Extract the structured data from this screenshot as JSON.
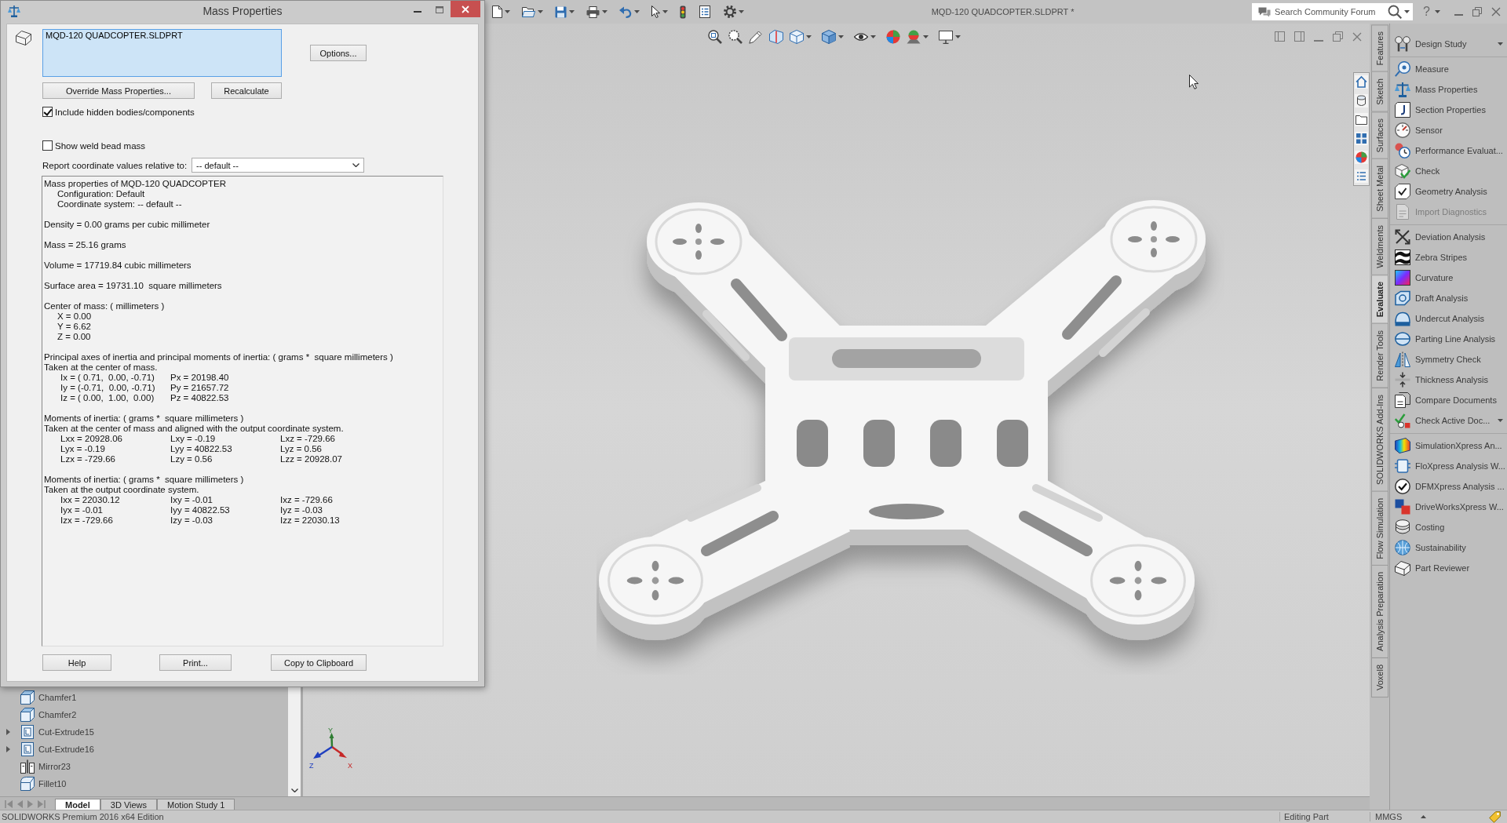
{
  "app": {
    "title": "MQD-120 QUADCOPTER.SLDPRT *",
    "search": {
      "placeholder": "Search Community Forum"
    },
    "help": "?"
  },
  "dialog": {
    "title": "Mass Properties",
    "selection": "MQD-120 QUADCOPTER.SLDPRT",
    "options_button": "Options...",
    "override_button": "Override Mass Properties...",
    "recalculate_button": "Recalculate",
    "checkboxes": [
      {
        "label": "Include hidden bodies/components",
        "checked": true
      },
      {
        "label": "Show weld bead mass",
        "checked": false
      }
    ],
    "coordinate_label": "Report coordinate values relative to:",
    "coordinate_select": "-- default --",
    "results": [
      {
        "lines": [
          "Mass properties of MQD-120 QUADCOPTER"
        ],
        "children": [
          "Configuration: Default",
          "Coordinate system: -- default --"
        ]
      },
      {
        "lines": [
          "Density = 0.00 grams per cubic millimeter"
        ]
      },
      {
        "lines": [
          "Mass = 25.16 grams"
        ]
      },
      {
        "lines": [
          "Volume = 17719.84 cubic millimeters"
        ]
      },
      {
        "lines": [
          "Surface area = 19731.10  square millimeters"
        ]
      },
      {
        "lines": [
          "Center of mass: ( millimeters )"
        ],
        "children": [
          "X = 0.00",
          "Y = 6.62",
          "Z = 0.00"
        ]
      },
      {
        "lines": [
          "Principal axes of inertia and principal moments of inertia: ( grams *  square millimeters )",
          "Taken at the center of mass."
        ],
        "rows": [
          [
            "Ix = ( 0.71,  0.00, -0.71)",
            "Px = 20198.40"
          ],
          [
            "Iy = (-0.71,  0.00, -0.71)",
            "Py = 21657.72"
          ],
          [
            "Iz = ( 0.00,  1.00,  0.00)",
            "Pz = 40822.53"
          ]
        ]
      },
      {
        "lines": [
          "Moments of inertia: ( grams *  square millimeters )",
          "Taken at the center of mass and aligned with the output coordinate system."
        ],
        "rows": [
          [
            "Lxx = 20928.06",
            "Lxy = -0.19",
            "Lxz = -729.66"
          ],
          [
            "Lyx = -0.19",
            "Lyy = 40822.53",
            "Lyz = 0.56"
          ],
          [
            "Lzx = -729.66",
            "Lzy = 0.56",
            "Lzz = 20928.07"
          ]
        ]
      },
      {
        "lines": [
          "Moments of inertia: ( grams *  square millimeters )",
          "Taken at the output coordinate system."
        ],
        "rows": [
          [
            "Ixx = 22030.12",
            "Ixy = -0.01",
            "Ixz = -729.66"
          ],
          [
            "Iyx = -0.01",
            "Iyy = 40822.53",
            "Iyz = -0.03"
          ],
          [
            "Izx = -729.66",
            "Izy = -0.03",
            "Izz = 22030.13"
          ]
        ]
      }
    ],
    "footer_buttons": [
      "Help",
      "Print...",
      "Copy to Clipboard"
    ]
  },
  "feature_tree": {
    "items": [
      {
        "label": "Chamfer1",
        "kind": "chamfer",
        "collapsed": false
      },
      {
        "label": "Chamfer2",
        "kind": "chamfer",
        "collapsed": false
      },
      {
        "label": "Cut-Extrude15",
        "kind": "cut-extrude",
        "collapsed": true
      },
      {
        "label": "Cut-Extrude16",
        "kind": "cut-extrude",
        "collapsed": true
      },
      {
        "label": "Mirror23",
        "kind": "mirror",
        "collapsed": false
      },
      {
        "label": "Fillet10",
        "kind": "fillet",
        "collapsed": false
      }
    ]
  },
  "graphics": {
    "triad": {
      "x": "X",
      "y": "Y",
      "z": "Z"
    }
  },
  "doc_tabs": [
    {
      "label": "Model",
      "selected": true
    },
    {
      "label": "3D Views",
      "selected": false
    },
    {
      "label": "Motion Study 1",
      "selected": false
    }
  ],
  "command_tabs": [
    {
      "label": "Features",
      "selected": false
    },
    {
      "label": "Sketch",
      "selected": false
    },
    {
      "label": "Surfaces",
      "selected": false
    },
    {
      "label": "Sheet Metal",
      "selected": false
    },
    {
      "label": "Weldments",
      "selected": false
    },
    {
      "label": "Evaluate",
      "selected": true
    },
    {
      "label": "Render Tools",
      "selected": false
    },
    {
      "label": "SOLIDWORKS Add-Ins",
      "selected": false
    },
    {
      "label": "Flow Simulation",
      "selected": false
    },
    {
      "label": "Analysis Preparation",
      "selected": false
    },
    {
      "label": "Voxel8",
      "selected": false
    }
  ],
  "command_groups": [
    {
      "items": [
        {
          "label": "Design Study",
          "kind": "design-study",
          "disabled": false,
          "dropdown": true
        }
      ]
    },
    {
      "items": [
        {
          "label": "Measure",
          "kind": "measure",
          "disabled": false,
          "dropdown": false
        },
        {
          "label": "Mass Properties",
          "kind": "mass-properties",
          "disabled": false,
          "dropdown": false
        },
        {
          "label": "Section Properties",
          "kind": "section-properties",
          "disabled": false,
          "dropdown": false
        },
        {
          "label": "Sensor",
          "kind": "sensor",
          "disabled": false,
          "dropdown": false
        },
        {
          "label": "Performance Evaluat...",
          "kind": "performance",
          "disabled": false,
          "dropdown": false
        },
        {
          "label": "Check",
          "kind": "check",
          "disabled": false,
          "dropdown": false
        },
        {
          "label": "Geometry Analysis",
          "kind": "geometry",
          "disabled": false,
          "dropdown": false
        },
        {
          "label": "Import Diagnostics",
          "kind": "import",
          "disabled": true,
          "dropdown": false
        }
      ]
    },
    {
      "items": [
        {
          "label": "Deviation Analysis",
          "kind": "deviation",
          "disabled": false,
          "dropdown": false
        },
        {
          "label": "Zebra Stripes",
          "kind": "zebra",
          "disabled": false,
          "dropdown": false
        },
        {
          "label": "Curvature",
          "kind": "curvature",
          "disabled": false,
          "dropdown": false
        },
        {
          "label": "Draft Analysis",
          "kind": "draft",
          "disabled": false,
          "dropdown": false
        },
        {
          "label": "Undercut Analysis",
          "kind": "undercut",
          "disabled": false,
          "dropdown": false
        },
        {
          "label": "Parting Line Analysis",
          "kind": "parting",
          "disabled": false,
          "dropdown": false
        },
        {
          "label": "Symmetry Check",
          "kind": "symmetry",
          "disabled": false,
          "dropdown": false
        },
        {
          "label": "Thickness Analysis",
          "kind": "thickness",
          "disabled": false,
          "dropdown": false
        },
        {
          "label": "Compare Documents",
          "kind": "compare",
          "disabled": false,
          "dropdown": false
        },
        {
          "label": "Check Active Doc...",
          "kind": "check-active",
          "disabled": false,
          "dropdown": true
        }
      ]
    },
    {
      "items": [
        {
          "label": "SimulationXpress An...",
          "kind": "simulation",
          "disabled": false,
          "dropdown": false
        },
        {
          "label": "FloXpress Analysis W...",
          "kind": "flow",
          "disabled": false,
          "dropdown": false
        },
        {
          "label": "DFMXpress Analysis ...",
          "kind": "dfm",
          "disabled": false,
          "dropdown": false
        },
        {
          "label": "DriveWorksXpress W...",
          "kind": "driveworks",
          "disabled": false,
          "dropdown": false
        },
        {
          "label": "Costing",
          "kind": "costing",
          "disabled": false,
          "dropdown": false
        },
        {
          "label": "Sustainability",
          "kind": "sustainability",
          "disabled": false,
          "dropdown": false
        },
        {
          "label": "Part Reviewer",
          "kind": "reviewer",
          "disabled": false,
          "dropdown": false
        }
      ]
    }
  ],
  "status_bar": {
    "product": "SOLIDWORKS Premium 2016 x64 Edition",
    "mode": "Editing Part",
    "units": "MMGS"
  }
}
